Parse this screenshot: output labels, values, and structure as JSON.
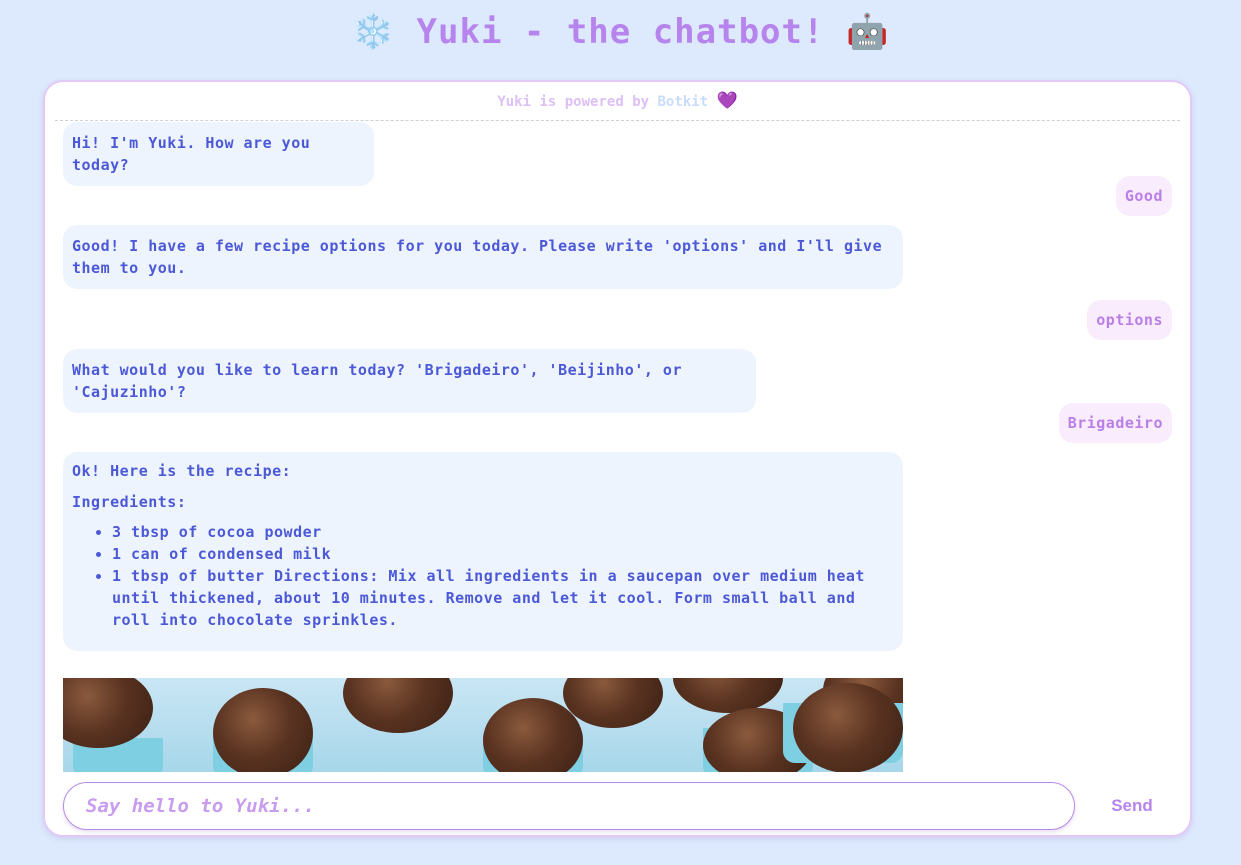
{
  "header": {
    "title_left_emoji": "❄️",
    "title": "Yuki - the chatbot!",
    "title_right_emoji": "🤖"
  },
  "powered": {
    "text": "Yuki is powered by",
    "link": "Botkit",
    "heart": "💜"
  },
  "messages": [
    {
      "from": "bot",
      "text": "Hi! I'm Yuki. How are you today?"
    },
    {
      "from": "user",
      "text": "Good"
    },
    {
      "from": "bot",
      "text": "Good! I have a few recipe options for you today. Please write 'options' and I'll give them to you."
    },
    {
      "from": "user",
      "text": "options"
    },
    {
      "from": "bot",
      "text": "What would you like to learn today? 'Brigadeiro', 'Beijinho', or 'Cajuzinho'?"
    },
    {
      "from": "user",
      "text": "Brigadeiro"
    },
    {
      "from": "bot",
      "intro": "Ok! Here is the recipe:",
      "heading": "Ingredients:",
      "items": [
        "3 tbsp of cocoa powder",
        "1 can of condensed milk",
        "1 tbsp of butter Directions: Mix all ingredients in a saucepan over medium heat until thickened, about 10 minutes. Remove and let it cool. Form small ball and roll into chocolate sprinkles."
      ]
    }
  ],
  "image": {
    "subject": "brigadeiro-photo"
  },
  "composer": {
    "placeholder": "Say hello to Yuki...",
    "value": "",
    "send_label": "Send"
  },
  "colors": {
    "background": "#dde9fd",
    "accent": "#b684ec",
    "bot_text": "#4c59d6",
    "bot_bubble": "#eef4fe",
    "user_bubble": "#f9ecfd"
  }
}
